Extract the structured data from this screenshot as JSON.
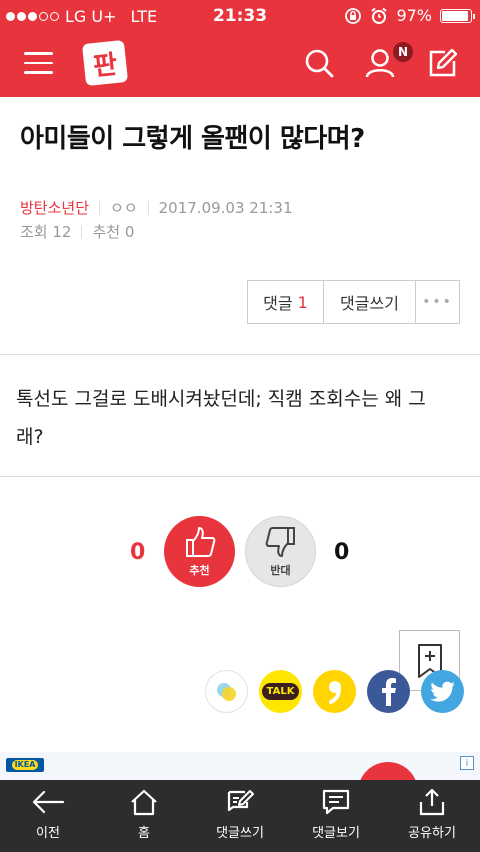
{
  "status_bar": {
    "carrier": "LG U+",
    "network": "LTE",
    "time": "21:33",
    "battery": "97%",
    "battery_level": 0.97
  },
  "header": {
    "logo": "판",
    "notification_badge": "N"
  },
  "post": {
    "title": "아미들이 그렇게 올팬이 많다며?",
    "category": "방탄소년단",
    "author": "ㅇㅇ",
    "datetime": "2017.09.03 21:31",
    "views_label": "조회",
    "views": "12",
    "recommend_label": "추천",
    "recommend_count": "0",
    "body_line1": "톡선도 그걸로 도배시켜놨던데; 직캠 조회수는 왜 그",
    "body_line2": "래?"
  },
  "actions": {
    "comment_label": "댓글",
    "comment_count": "1",
    "write_comment": "댓글쓰기",
    "more": "•••"
  },
  "votes": {
    "up_count": "0",
    "up_label": "추천",
    "down_count": "0",
    "down_label": "반대"
  },
  "share": {
    "kakaotalk_label": "TALK"
  },
  "ad": {
    "brand": "IKEA",
    "info": "i"
  },
  "toolbar": {
    "back": "이전",
    "home": "홈",
    "write_comment": "댓글쓰기",
    "view_comments": "댓글보기",
    "share": "공유하기"
  },
  "colors": {
    "brand_red": "#e8343d",
    "toolbar_bg": "#2d2d2d"
  }
}
